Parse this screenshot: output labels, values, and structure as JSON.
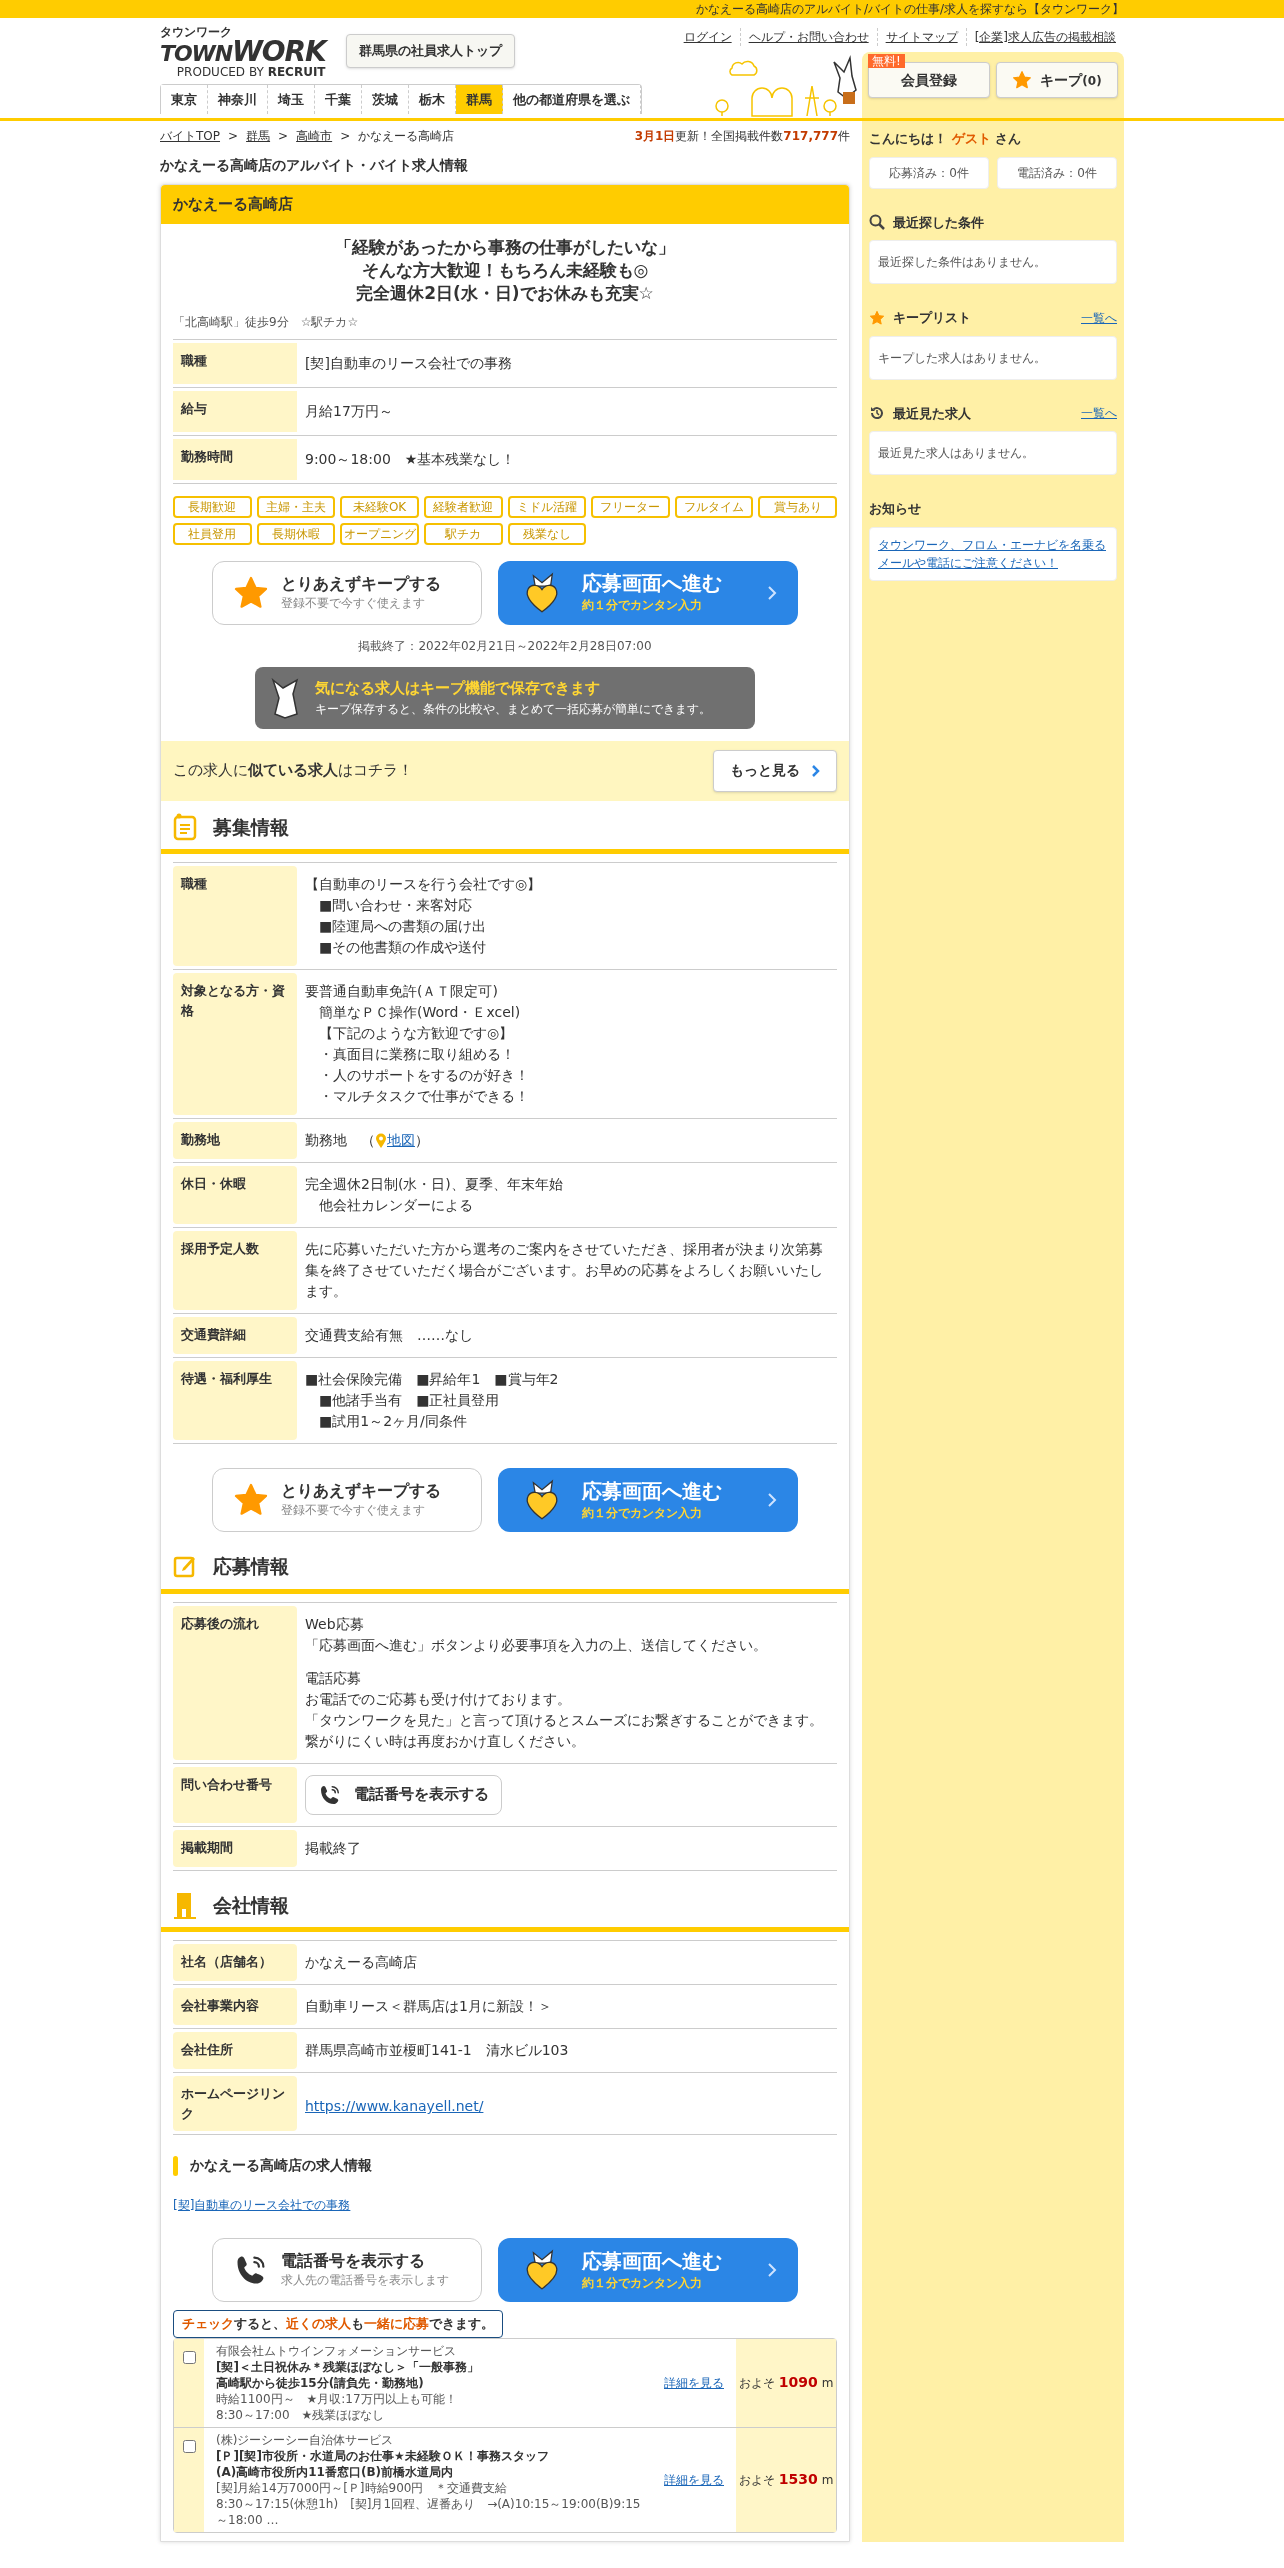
{
  "top_bar": {
    "text": "かなえーる高崎店のアルバイト/バイトの仕事/求人を探すなら【タウンワーク】"
  },
  "header": {
    "logo": {
      "kana": "タウンワーク",
      "word1": "TOWN",
      "word2": "WORK",
      "produced_by": "PRODUCED BY",
      "company": "RECRUIT"
    },
    "top_button": "群馬県の社員求人トップ",
    "links": [
      "ログイン",
      "ヘルプ・お問い合わせ",
      "サイトマップ",
      "[企業]求人広告の掲載相談"
    ],
    "member_button": {
      "label": "会員登録",
      "badge": "無料!"
    },
    "keep_button": {
      "label": "キープ",
      "count": "(0)"
    },
    "prefecture_tabs": [
      {
        "label": "東京",
        "selected": false
      },
      {
        "label": "神奈川",
        "selected": false
      },
      {
        "label": "埼玉",
        "selected": false
      },
      {
        "label": "千葉",
        "selected": false
      },
      {
        "label": "茨城",
        "selected": false
      },
      {
        "label": "栃木",
        "selected": false
      },
      {
        "label": "群馬",
        "selected": true
      },
      {
        "label": "他の都道府県を選ぶ",
        "selected": false
      }
    ]
  },
  "breadcrumbs": [
    {
      "label": "バイトTOP"
    },
    {
      "separator": ">",
      "label": "群馬"
    },
    {
      "separator": ">",
      "label": "高崎市"
    },
    {
      "separator": ">",
      "label": "かなえーる高崎店"
    }
  ],
  "update_notice": {
    "date": "3月1日",
    "text": "更新！全国掲載件数",
    "count": "717,777",
    "suffix": "件"
  },
  "page_title": "かなえーる高崎店のアルバイト・バイト求人情報",
  "job_card": {
    "store_name": "かなえーる高崎店",
    "catch_lines": [
      "「経験があったから事務の仕事がしたいな」",
      "そんな方大歓迎！もちろん未経験も◎",
      "完全週休2日(水・日)でお休みも充実☆"
    ],
    "access": "「北高崎駅」徒歩9分　☆駅チカ☆",
    "summary": [
      {
        "label": "職種",
        "value": "[契]自動車のリース会社での事務"
      },
      {
        "label": "給与",
        "value": "月給17万円～"
      },
      {
        "label": "勤務時間",
        "value": "9:00～18:00　★基本残業なし！"
      }
    ],
    "tags": [
      "長期歓迎",
      "主婦・主夫",
      "未経験OK",
      "経験者歓迎",
      "ミドル活躍",
      "フリーター",
      "フルタイム",
      "賞与あり",
      "社員登用",
      "長期休暇",
      "オープニング",
      "駅チカ",
      "残業なし"
    ],
    "actions": {
      "secondary": {
        "kind": "keep",
        "title": "とりあえずキープする",
        "subtitle": "登録不要で今すぐ使えます"
      },
      "apply": {
        "title": "応募画面へ進む",
        "subtitle": "約１分でカンタン入力"
      }
    },
    "posting_period": "掲載終了：2022年02月21日～2022年2月28日07:00",
    "keep_banner": {
      "title": "気になる求人はキープ機能で保存できます",
      "text": "キープ保存すると、条件の比較や、まとめて一括応募が簡単にできます。"
    },
    "similar": {
      "text": "この求人に**似ている求人**はコチラ！",
      "button": "もっと見る"
    }
  },
  "recruitment": {
    "title": "募集情報",
    "rows": [
      {
        "kind": "text",
        "label": "職種",
        "paragraphs": [
          [
            "【自動車のリースを行う会社です◎】",
            "　■問い合わせ・来客対応",
            "　■陸運局への書類の届け出",
            "　■その他書類の作成や送付"
          ]
        ]
      },
      {
        "kind": "text",
        "label": "対象となる方・資格",
        "paragraphs": [
          [
            "要普通自動車免許(ＡＴ限定可)",
            "　簡単なＰＣ操作(Word・Ｅxcel)",
            "　【下記のような方歓迎です◎】",
            "　・真面目に業務に取り組める！",
            "　・人のサポートをするのが好き！",
            "　・マルチタスクで仕事ができる！"
          ]
        ]
      },
      {
        "kind": "map",
        "label": "勤務地",
        "value": "勤務地　（",
        "link": "地図",
        "close": "）"
      },
      {
        "kind": "text",
        "label": "休日・休暇",
        "paragraphs": [
          [
            "完全週休2日制(水・日)、夏季、年末年始",
            "　他会社カレンダーによる"
          ]
        ]
      },
      {
        "kind": "text",
        "label": "採用予定人数",
        "paragraphs": [
          [
            "先に応募いただいた方から選考のご案内をさせていただき、採用者が決まり次第募集を終了させていただく場合がございます。お早めの応募をよろしくお願いいたします。"
          ]
        ]
      },
      {
        "kind": "text",
        "label": "交通費詳細",
        "paragraphs": [
          [
            "交通費支給有無　……なし"
          ]
        ]
      },
      {
        "kind": "text",
        "label": "待遇・福利厚生",
        "paragraphs": [
          [
            "■社会保険完備　■昇給年1　■賞与年2",
            "　■他諸手当有　■正社員登用",
            "　■試用1～2ヶ月/同条件"
          ]
        ]
      }
    ],
    "actions": {
      "secondary": {
        "kind": "keep",
        "title": "とりあえずキープする",
        "subtitle": "登録不要で今すぐ使えます"
      },
      "apply": {
        "title": "応募画面へ進む",
        "subtitle": "約１分でカンタン入力"
      }
    }
  },
  "application": {
    "title": "応募情報",
    "rows": [
      {
        "kind": "text",
        "label": "応募後の流れ",
        "paragraphs": [
          [
            "Web応募",
            "「応募画面へ進む」ボタンより必要事項を入力の上、送信してください。"
          ],
          [
            "電話応募",
            "お電話でのご応募も受け付けております。",
            "「タウンワークを見た」と言って頂けるとスムーズにお繋ぎすることができます。繋がりにくい時は再度おかけ直しください。"
          ]
        ]
      },
      {
        "kind": "phone",
        "label": "問い合わせ番号",
        "button": "電話番号を表示する"
      },
      {
        "kind": "text",
        "label": "掲載期間",
        "paragraphs": [
          [
            "掲載終了"
          ]
        ]
      }
    ]
  },
  "company": {
    "title": "会社情報",
    "rows": [
      {
        "kind": "text",
        "label": "社名（店舗名）",
        "paragraphs": [
          [
            "かなえーる高崎店"
          ]
        ]
      },
      {
        "kind": "text",
        "label": "会社事業内容",
        "paragraphs": [
          [
            "自動車リース＜群馬店は1月に新設！＞"
          ]
        ]
      },
      {
        "kind": "text",
        "label": "会社住所",
        "paragraphs": [
          [
            "群馬県高崎市並榎町141-1　清水ビル103"
          ]
        ]
      },
      {
        "kind": "url",
        "label": "ホームページリンク",
        "link": "https://www.kanayell.net/"
      }
    ]
  },
  "store_jobs": {
    "title": "かなえーる高崎店の求人情報",
    "links": [
      "[契]自動車のリース会社での事務"
    ],
    "actions": {
      "secondary": {
        "kind": "phone",
        "title": "電話番号を表示する",
        "subtitle": "求人先の電話番号を表示します"
      },
      "apply": {
        "title": "応募画面へ進む",
        "subtitle": "約１分でカンタン入力"
      }
    }
  },
  "nearby": {
    "hint": [
      {
        "text": "チェック",
        "highlight": true
      },
      {
        "text": "すると、",
        "highlight": false
      },
      {
        "text": "近くの求人",
        "highlight": true
      },
      {
        "text": "も",
        "highlight": false
      },
      {
        "text": "一緒に応募",
        "highlight": true
      },
      {
        "text": "できます。",
        "highlight": false
      }
    ],
    "jobs": [
      {
        "checked": false,
        "company": "有限会社ムトウインフォメーションサービス",
        "title": "[契]＜土日祝休み＊残業ほぼなし＞「一般事務」",
        "access": "高崎駅から徒歩15分(請負先・勤務地)",
        "pay": "時給1100円～　★月収:17万円以上も可能！",
        "hours": "8:30～17:00　★残業ほぼなし",
        "detail": "詳細を見る",
        "distance_prefix": "およそ",
        "distance": "1090",
        "unit": "m"
      },
      {
        "checked": false,
        "company": "(株)ジーシーシー自治体サービス",
        "title": "[Ｐ][契]市役所・水道局のお仕事★未経験ＯＫ！事務スタッフ",
        "access": "(A)高崎市役所内11番窓口(B)前橋水道局内",
        "pay": "[契]月給14万7000円～[Ｐ]時給900円　＊交通費支給",
        "hours": "8:30～17:15(休憩1h)　[契]月1回程、遅番あり　→(A)10:15～19:00(B)9:15～18:00 …",
        "detail": "詳細を見る",
        "distance_prefix": "およそ",
        "distance": "1530",
        "unit": "m"
      }
    ]
  },
  "sidebar": {
    "greeting": {
      "prefix": "こんにちは！",
      "name": "ゲスト",
      "suffix": "さん"
    },
    "counters": [
      "応募済み：0件",
      "電話済み：0件"
    ],
    "sections": [
      {
        "kind": "search",
        "title": "最近探した条件",
        "empty": "最近探した条件はありません。"
      },
      {
        "kind": "keep",
        "title": "キープリスト",
        "link": "一覧へ",
        "empty": "キープした求人はありません。"
      },
      {
        "kind": "history",
        "title": "最近見た求人",
        "link": "一覧へ",
        "empty": "最近見た求人はありません。"
      }
    ],
    "notice": {
      "title": "お知らせ",
      "link": "タウンワーク、フロム・エーナビを名乗るメールや電話にご注意ください！"
    }
  }
}
